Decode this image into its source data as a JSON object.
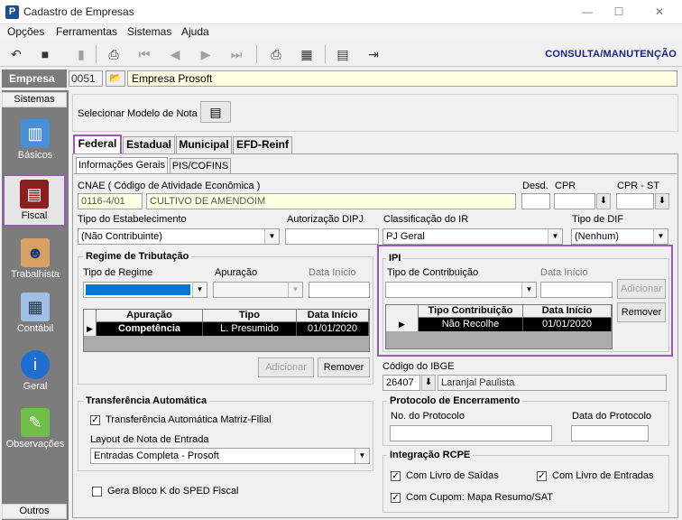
{
  "window": {
    "title": "Cadastro de Empresas",
    "icon_letter": "P",
    "minimize": "—",
    "maximize": "☐",
    "close": "✕"
  },
  "menu": [
    "Opções",
    "Ferramentas",
    "Sistemas",
    "Ajuda"
  ],
  "toolbar": {
    "mode": "CONSULTA/MANUTENÇÃO"
  },
  "empresa": {
    "label": "Empresa",
    "code": "0051",
    "name": "Empresa Prosoft"
  },
  "sidebar": {
    "header": "Sistemas",
    "footer": "Outros",
    "items": [
      {
        "label": "Básicos",
        "icon": "book-icon"
      },
      {
        "label": "Fiscal",
        "icon": "ledger-icon"
      },
      {
        "label": "Trabalhista",
        "icon": "worker-icon"
      },
      {
        "label": "Contábil",
        "icon": "calculator-icon"
      },
      {
        "label": "Geral",
        "icon": "info-icon"
      },
      {
        "label": "Observações",
        "icon": "note-icon"
      }
    ]
  },
  "modelo": {
    "label": "Selecionar Modelo de Nota"
  },
  "tabs": [
    "Federal",
    "Estadual",
    "Municipal",
    "EFD-Reinf"
  ],
  "subtabs": [
    "Informações Gerais",
    "PIS/COFINS"
  ],
  "cnae": {
    "label": "CNAE ( Código de  Atividade Econômica )",
    "code": "0116-4/01",
    "desc": "CULTIVO DE AMENDOIM"
  },
  "desd": {
    "label": "Desd.",
    "value": ""
  },
  "cpr": {
    "label": "CPR",
    "value": ""
  },
  "cpr_st": {
    "label": "CPR - ST",
    "value": ""
  },
  "tipo_estab": {
    "label": "Tipo do Estabelecimento",
    "value": "(Não Contribuinte)"
  },
  "aut_dipj": {
    "label": "Autorização DIPJ",
    "value": ""
  },
  "class_ir": {
    "label": "Classificação do IR",
    "value": "PJ Geral"
  },
  "tipo_dif": {
    "label": "Tipo de DIF",
    "value": "(Nenhum)"
  },
  "regime": {
    "title": "Regime de Tributação",
    "tipo_label": "Tipo de Regime",
    "apuracao_label": "Apuração",
    "data_label": "Data Início",
    "columns": [
      "Apuração",
      "Tipo",
      "Data Início"
    ],
    "rows": [
      {
        "apuracao": "Competência",
        "tipo": "L. Presumido",
        "data": "01/01/2020"
      }
    ],
    "add": "Adicionar",
    "remove": "Remover"
  },
  "ipi": {
    "title": "IPI",
    "tipo_label": "Tipo de Contribuição",
    "data_label": "Data Início",
    "columns": [
      "Tipo Contribuição",
      "Data Início"
    ],
    "rows": [
      {
        "tipo": "Não Recolhe",
        "data": "01/01/2020"
      }
    ],
    "add": "Adicionar",
    "remove": "Remover"
  },
  "ibge": {
    "label": "Código do IBGE",
    "code": "26407",
    "name": "Laranjal Paulista"
  },
  "transf": {
    "title": "Transferência Automática",
    "check_label": "Transferência Automática Matriz-Filial",
    "checked": true,
    "layout_label": "Layout de Nota de Entrada",
    "layout_value": "Entradas Completa - Prosoft"
  },
  "protocolo": {
    "title": "Protocolo de Encerramento",
    "no_label": "No. do Protocolo",
    "data_label": "Data do Protocolo"
  },
  "rcpe": {
    "title": "Integração RCPE",
    "saidas": "Com Livro de Saídas",
    "entradas": "Com Livro de Entradas",
    "cupom": "Com Cupom: Mapa Resumo/SAT"
  },
  "bloco_k": {
    "label": "Gera Bloco K do SPED Fiscal",
    "checked": false
  }
}
